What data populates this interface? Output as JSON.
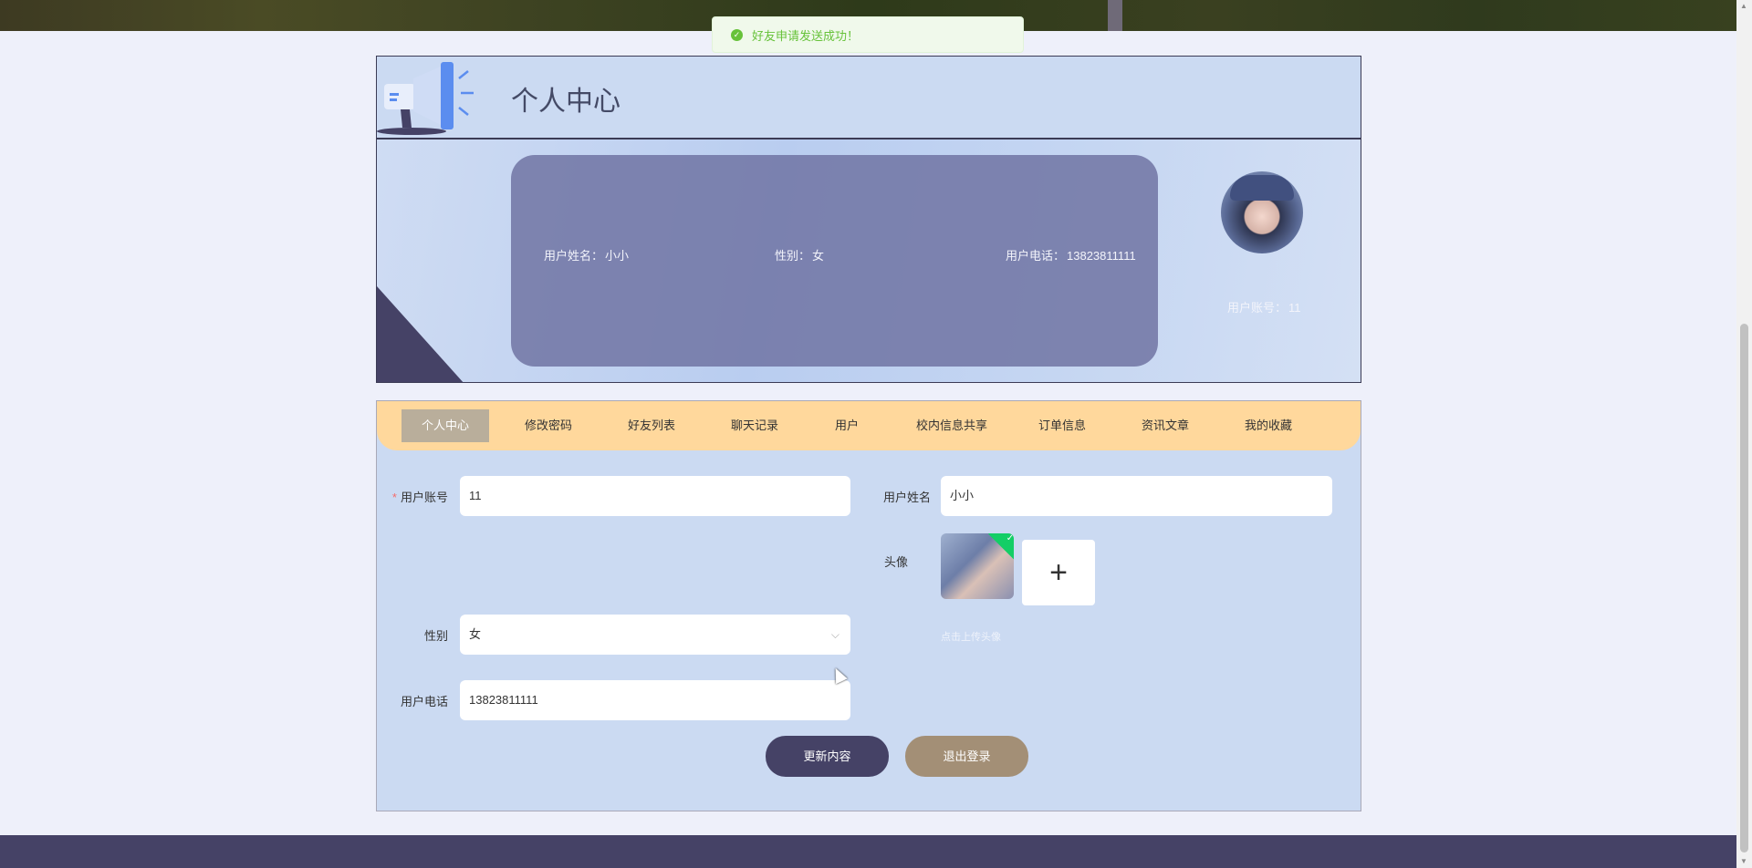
{
  "toast": {
    "message": "好友申请发送成功！",
    "icon": "check-circle-icon",
    "color": "#67c23a"
  },
  "profile": {
    "title": "个人中心",
    "name_label": "用户姓名：",
    "name": "小小",
    "gender_label": "性别：",
    "gender": "女",
    "phone_label": "用户电话：",
    "phone": "13823811111",
    "account_label": "用户账号：",
    "account": "11"
  },
  "tabs": [
    {
      "label": "个人中心",
      "active": true
    },
    {
      "label": "修改密码"
    },
    {
      "label": "好友列表"
    },
    {
      "label": "聊天记录"
    },
    {
      "label": "用户"
    },
    {
      "label": "校内信息共享"
    },
    {
      "label": "订单信息"
    },
    {
      "label": "资讯文章"
    },
    {
      "label": "我的收藏"
    }
  ],
  "form": {
    "account_label": "用户账号",
    "account_required": "*",
    "account_value": "11",
    "name_label": "用户姓名",
    "name_value": "小小",
    "avatar_label": "头像",
    "upload_plus": "+",
    "upload_hint": "点击上传头像",
    "upload_success_icon": "✓",
    "gender_label": "性别",
    "gender_value": "女",
    "phone_label": "用户电话",
    "phone_value": "13823811111"
  },
  "buttons": {
    "update": "更新内容",
    "logout": "退出登录"
  },
  "colors": {
    "accent_dark": "#454266",
    "logout": "#a38f76",
    "tab_bar": "#ffd89c",
    "active_tab": "#b9ae9b"
  }
}
